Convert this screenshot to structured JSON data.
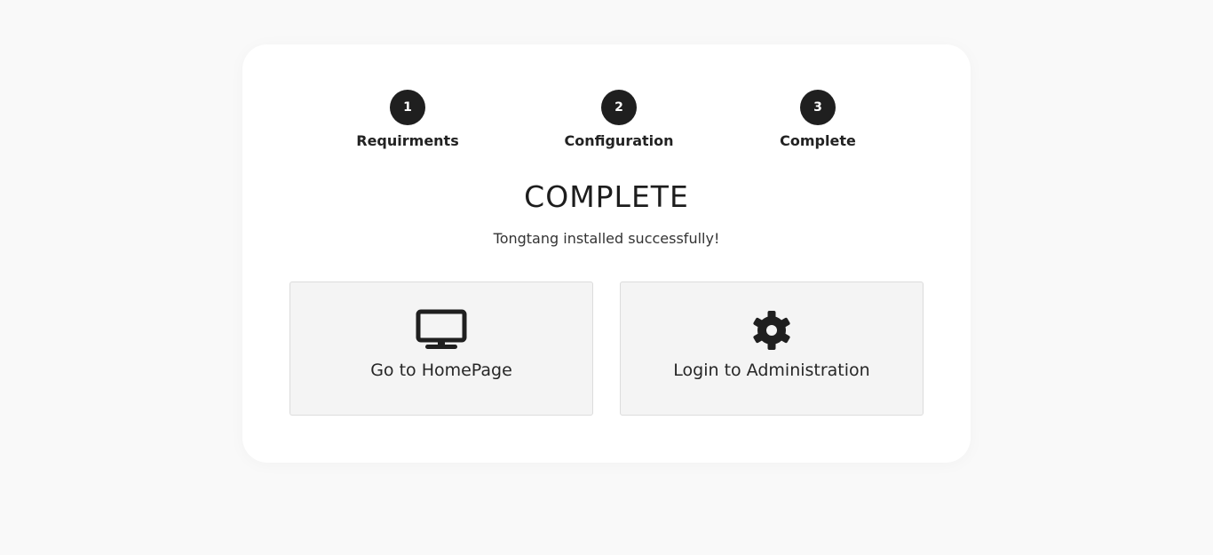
{
  "steps": [
    {
      "number": "1",
      "label": "Requirments"
    },
    {
      "number": "2",
      "label": "Configuration"
    },
    {
      "number": "3",
      "label": "Complete"
    }
  ],
  "title": "COMPLETE",
  "subtitle": "Tongtang installed successfully!",
  "actions": [
    {
      "label": "Go to HomePage",
      "icon": "monitor-icon"
    },
    {
      "label": "Login to Administration",
      "icon": "gear-icon"
    }
  ],
  "colors": {
    "page_background": "#f9f9f9",
    "card_background": "#ffffff",
    "step_circle": "#1f1f1f",
    "action_background": "#f4f4f4",
    "action_border": "#dcdcdc"
  }
}
